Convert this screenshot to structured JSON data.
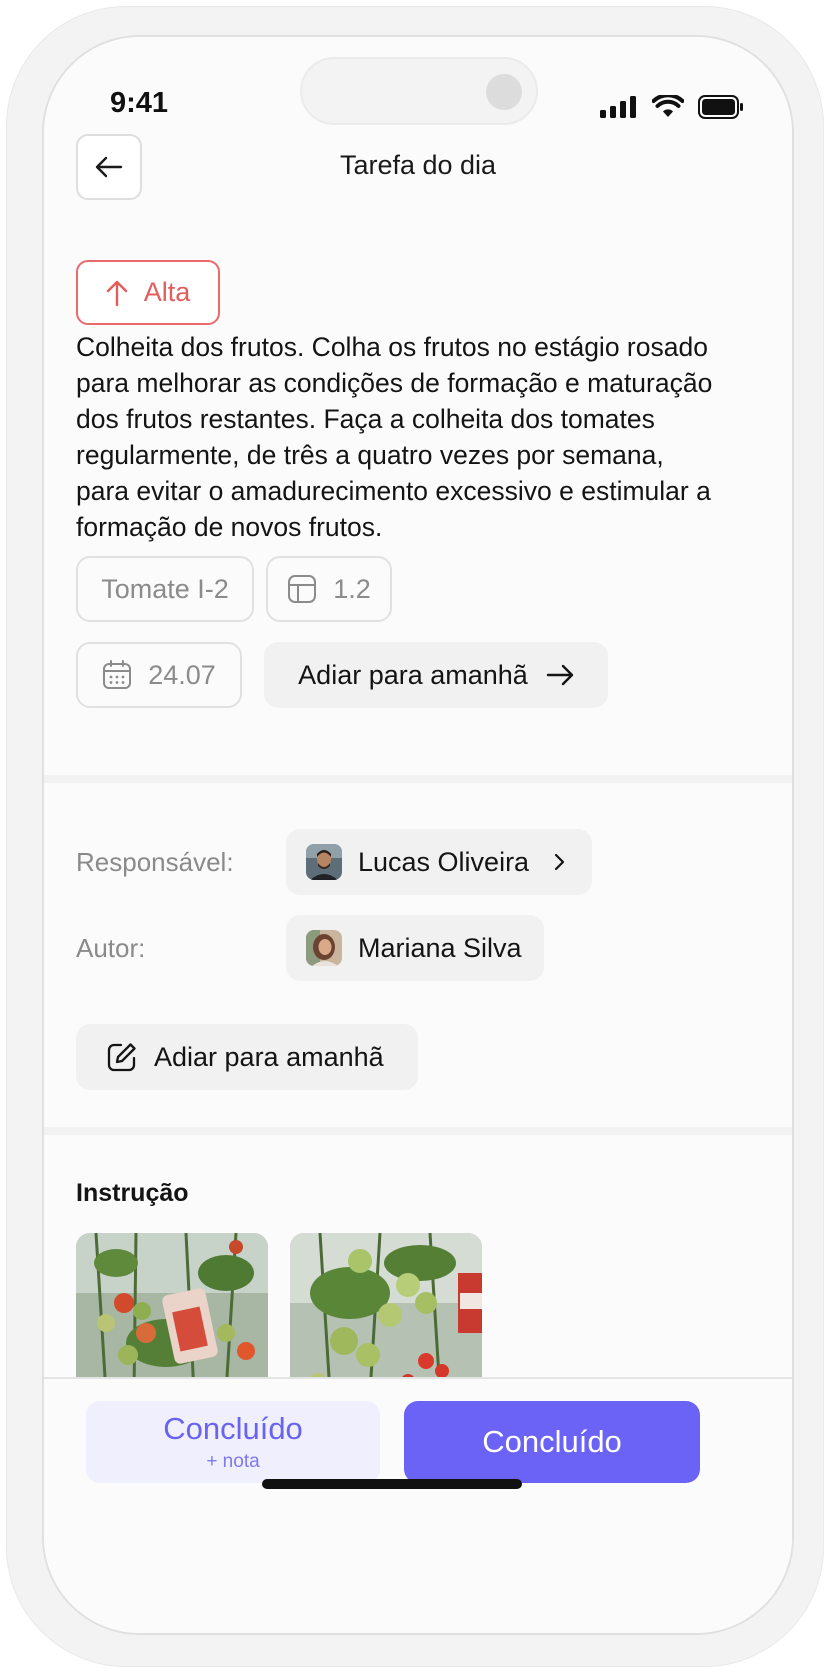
{
  "status_bar": {
    "time": "9:41"
  },
  "header": {
    "title": "Tarefa do dia"
  },
  "priority": {
    "label": "Alta",
    "color": "#e35d5d"
  },
  "task": {
    "description": "Colheita dos frutos. Colha os frutos no estágio rosado para melhorar as condições de formação e maturação dos frutos restantes. Faça a colheita dos tomates regularmente, de três a quatro vezes por semana, para evitar o amadurecimento excessivo e estimular a formação de novos frutos.",
    "crop": "Tomate I-2",
    "plot": "1.2",
    "date": "24.07",
    "postpone_label": "Adiar para amanhã"
  },
  "people": {
    "responsible_label": "Responsável:",
    "responsible_name": "Lucas Oliveira",
    "author_label": "Autor:",
    "author_name": "Mariana Silva"
  },
  "edit_button": {
    "label": "Adiar para amanhã"
  },
  "instruction": {
    "title": "Instrução"
  },
  "footer": {
    "secondary_main": "Concluído",
    "secondary_sub": "+ nota",
    "primary": "Concluído"
  },
  "colors": {
    "accent": "#6a63f5",
    "accent_light": "#efeffd"
  }
}
